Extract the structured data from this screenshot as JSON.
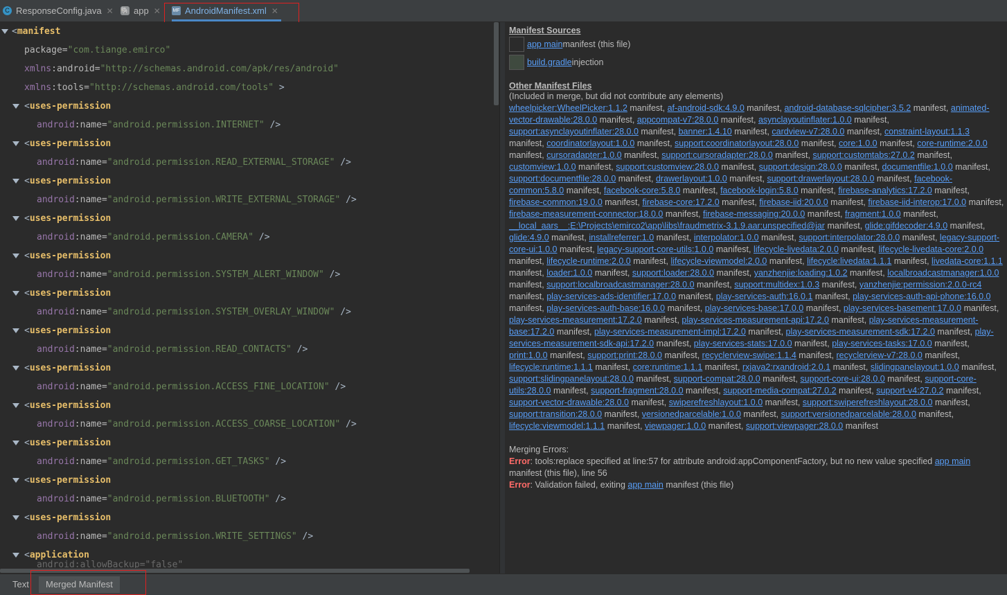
{
  "tabs": [
    {
      "label": "ResponseConfig.java",
      "icon": "java-class-icon"
    },
    {
      "label": "app",
      "icon": "gradle-icon"
    },
    {
      "label": "AndroidManifest.xml",
      "icon": "manifest-file-icon"
    }
  ],
  "editor": {
    "root": {
      "tag": "manifest",
      "package_attr": "package",
      "package_val": "\"com.tiange.emirco\"",
      "xmlns_android_ns": "xmlns",
      "xmlns_android_name": ":android=",
      "xmlns_android_val": "\"http://schemas.android.com/apk/res/android\"",
      "xmlns_tools_ns": "xmlns",
      "xmlns_tools_name": ":tools=",
      "xmlns_tools_val": "\"http://schemas.android.com/tools\"",
      "close": " >"
    },
    "perm_tag": "uses-permission",
    "perm_ns": "android",
    "perm_attr": ":name=",
    "perm_close": " />",
    "permissions": [
      "\"android.permission.INTERNET\"",
      "\"android.permission.READ_EXTERNAL_STORAGE\"",
      "\"android.permission.WRITE_EXTERNAL_STORAGE\"",
      "\"android.permission.CAMERA\"",
      "\"android.permission.SYSTEM_ALERT_WINDOW\"",
      "\"android.permission.SYSTEM_OVERLAY_WINDOW\"",
      "\"android.permission.READ_CONTACTS\"",
      "\"android.permission.ACCESS_FINE_LOCATION\"",
      "\"android.permission.ACCESS_COARSE_LOCATION\"",
      "\"android.permission.GET_TASKS\"",
      "\"android.permission.BLUETOOTH\"",
      "\"android.permission.WRITE_SETTINGS\""
    ],
    "app_tag": "application",
    "partial_line": "android:allowBackup=\"false\""
  },
  "panel": {
    "sources_title": "Manifest Sources",
    "sources": [
      {
        "link": "app main",
        "text": " manifest (this file)",
        "color": "#2b2b2b"
      },
      {
        "link": "build.gradle",
        "text": " injection",
        "color": "#3f4a3f"
      }
    ],
    "other_title": "Other Manifest Files",
    "other_note": "(Included in merge, but did not contribute any elements)",
    "suffix": " manifest, ",
    "last_suffix": " manifest",
    "deps": [
      "wheelpicker:WheelPicker:1.1.2",
      "af-android-sdk:4.9.0",
      "android-database-sqlcipher:3.5.2",
      "animated-vector-drawable:28.0.0",
      "appcompat-v7:28.0.0",
      "asynclayoutinflater:1.0.0",
      "support:asynclayoutinflater:28.0.0",
      "banner:1.4.10",
      "cardview-v7:28.0.0",
      "constraint-layout:1.1.3",
      "coordinatorlayout:1.0.0",
      "support:coordinatorlayout:28.0.0",
      "core:1.0.0",
      "core-runtime:2.0.0",
      "cursoradapter:1.0.0",
      "support:cursoradapter:28.0.0",
      "support:customtabs:27.0.2",
      "customview:1.0.0",
      "support:customview:28.0.0",
      "support:design:28.0.0",
      "documentfile:1.0.0",
      "support:documentfile:28.0.0",
      "drawerlayout:1.0.0",
      "support:drawerlayout:28.0.0",
      "facebook-common:5.8.0",
      "facebook-core:5.8.0",
      "facebook-login:5.8.0",
      "firebase-analytics:17.2.0",
      "firebase-common:19.0.0",
      "firebase-core:17.2.0",
      "firebase-iid:20.0.0",
      "firebase-iid-interop:17.0.0",
      "firebase-measurement-connector:18.0.0",
      "firebase-messaging:20.0.0",
      "fragment:1.0.0",
      "__local_aars__:E:\\Projects\\emirco2\\app\\libs\\fraudmetrix-3.1.9.aar:unspecified@jar",
      "glide:gifdecoder:4.9.0",
      "glide:4.9.0",
      "installreferrer:1.0",
      "interpolator:1.0.0",
      "support:interpolator:28.0.0",
      "legacy-support-core-ui:1.0.0",
      "legacy-support-core-utils:1.0.0",
      "lifecycle-livedata:2.0.0",
      "lifecycle-livedata-core:2.0.0",
      "lifecycle-runtime:2.0.0",
      "lifecycle-viewmodel:2.0.0",
      "lifecycle:livedata:1.1.1",
      "livedata-core:1.1.1",
      "loader:1.0.0",
      "support:loader:28.0.0",
      "yanzhenjie:loading:1.0.2",
      "localbroadcastmanager:1.0.0",
      "support:localbroadcastmanager:28.0.0",
      "support:multidex:1.0.3",
      "yanzhenjie:permission:2.0.0-rc4",
      "play-services-ads-identifier:17.0.0",
      "play-services-auth:16.0.1",
      "play-services-auth-api-phone:16.0.0",
      "play-services-auth-base:16.0.0",
      "play-services-base:17.0.0",
      "play-services-basement:17.0.0",
      "play-services-measurement:17.2.0",
      "play-services-measurement-api:17.2.0",
      "play-services-measurement-base:17.2.0",
      "play-services-measurement-impl:17.2.0",
      "play-services-measurement-sdk:17.2.0",
      "play-services-measurement-sdk-api:17.2.0",
      "play-services-stats:17.0.0",
      "play-services-tasks:17.0.0",
      "print:1.0.0",
      "support:print:28.0.0",
      "recyclerview-swipe:1.1.4",
      "recyclerview-v7:28.0.0",
      "lifecycle:runtime:1.1.1",
      "core:runtime:1.1.1",
      "rxjava2:rxandroid:2.0.1",
      "slidingpanelayout:1.0.0",
      "support:slidingpanelayout:28.0.0",
      "support-compat:28.0.0",
      "support-core-ui:28.0.0",
      "support-core-utils:28.0.0",
      "support-fragment:28.0.0",
      "support-media-compat:27.0.2",
      "support-v4:27.0.2",
      "support-vector-drawable:28.0.0",
      "swiperefreshlayout:1.0.0",
      "support:swiperefreshlayout:28.0.0",
      "support:transition:28.0.0",
      "versionedparcelable:1.0.0",
      "support:versionedparcelable:28.0.0",
      "lifecycle:viewmodel:1.1.1",
      "viewpager:1.0.0",
      "support:viewpager:28.0.0"
    ],
    "errors_title": "Merging Errors:",
    "errors": [
      {
        "label": "Error",
        "text": ": tools:replace specified at line:57 for attribute android:appComponentFactory, but no new value specified ",
        "link": "app main",
        "tail": " manifest (this file), line 56"
      },
      {
        "label": "Error",
        "text": ": Validation failed, exiting ",
        "link": "app main",
        "tail": " manifest (this file)"
      }
    ]
  },
  "bottom_tabs": [
    {
      "label": "Text",
      "selected": false
    },
    {
      "label": "Merged Manifest",
      "selected": true
    }
  ]
}
